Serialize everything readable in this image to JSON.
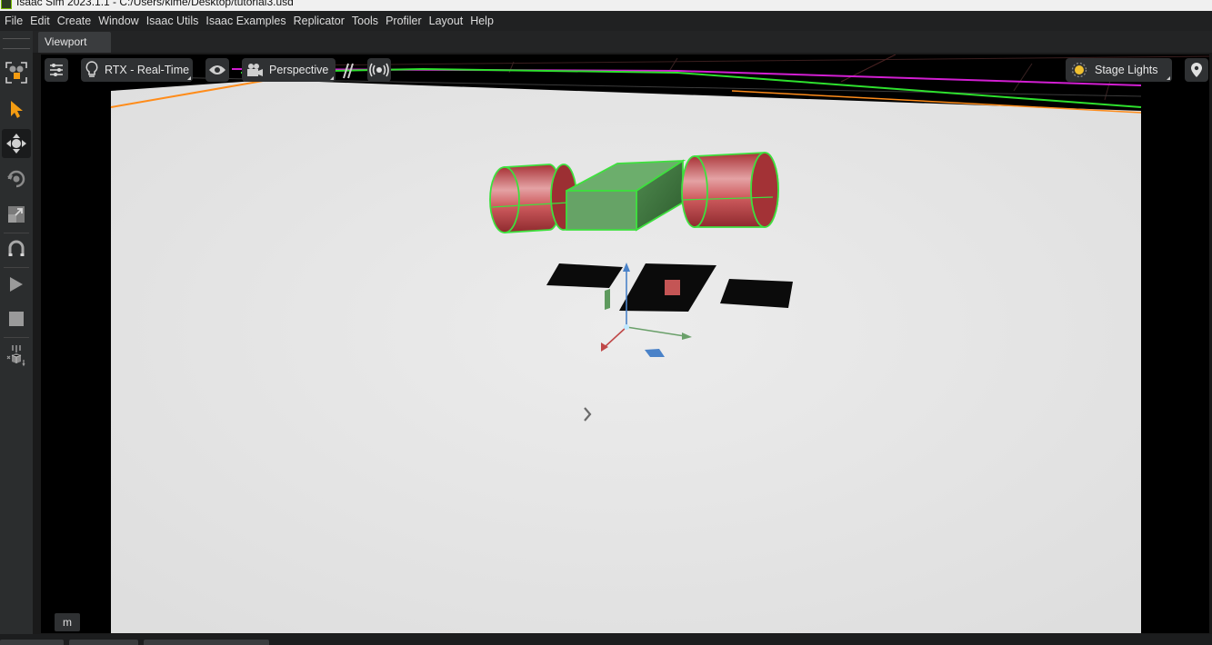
{
  "window": {
    "title": "Isaac Sim 2023.1.1 - C:/Users/kime/Desktop/tutorial3.usd"
  },
  "menu": {
    "items": [
      "File",
      "Edit",
      "Create",
      "Window",
      "Isaac Utils",
      "Isaac Examples",
      "Replicator",
      "Tools",
      "Profiler",
      "Layout",
      "Help"
    ]
  },
  "tabs": {
    "viewport": "Viewport"
  },
  "viewport": {
    "renderer_label": "RTX - Real-Time",
    "camera_label": "Perspective",
    "lights_label": "Stage Lights",
    "units_label": "m"
  },
  "toolbar": {
    "tools": [
      "select-mode-icon",
      "select-icon",
      "move-icon",
      "rotate-icon",
      "scale-icon",
      "snap-icon",
      "play-icon",
      "stop-icon",
      "physics-icon"
    ]
  },
  "colors": {
    "accent_green": "#76b900",
    "selection_outline": "#3ee03e",
    "cylinder_red": "#c8494c",
    "box_green": "#5e9e5e",
    "ground": "#e4e4e4"
  }
}
